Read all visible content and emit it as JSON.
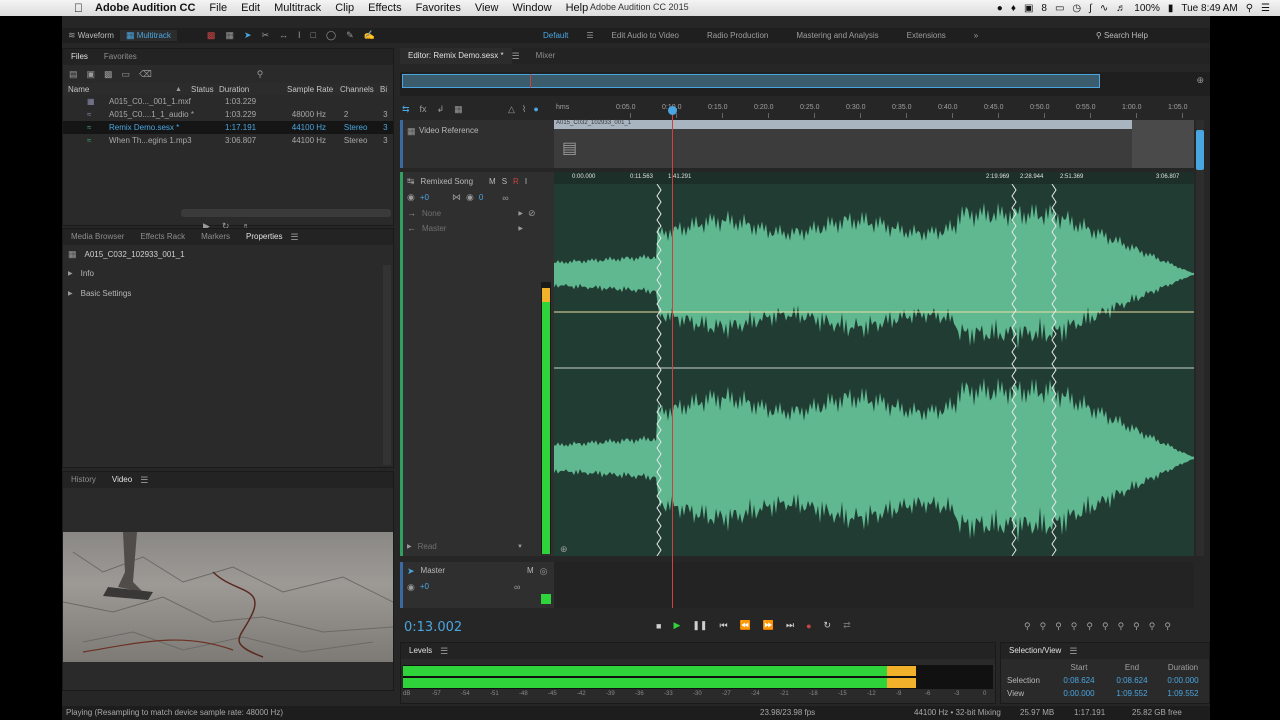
{
  "menubar": {
    "app": "Adobe Audition CC",
    "items": [
      "File",
      "Edit",
      "Multitrack",
      "Clip",
      "Effects",
      "Favorites",
      "View",
      "Window",
      "Help"
    ],
    "window_title": "Adobe Audition CC 2015",
    "tray": {
      "notifications": "8",
      "battery": "100%",
      "clock": "Tue 8:49 AM"
    }
  },
  "toolbar": {
    "waveform": "Waveform",
    "multitrack": "Multitrack",
    "workspaces": [
      "Default",
      "Edit Audio to Video",
      "Radio Production",
      "Mastering and Analysis",
      "Extensions"
    ],
    "search_help": "Search Help"
  },
  "files_panel": {
    "tabs": [
      "Files",
      "Favorites"
    ],
    "columns": [
      "Name",
      "Status",
      "Duration",
      "Sample Rate",
      "Channels",
      "Bi"
    ],
    "rows": [
      {
        "name": "A015_C0..._001_1.mxf",
        "status": "",
        "duration": "1:03.229",
        "rate": "",
        "channels": "",
        "bits": ""
      },
      {
        "name": "A015_C0....1_1_audio *",
        "status": "",
        "duration": "1:03.229",
        "rate": "48000 Hz",
        "channels": "2",
        "bits": "3"
      },
      {
        "name": "Remix Demo.sesx *",
        "status": "",
        "duration": "1:17.191",
        "rate": "44100 Hz",
        "channels": "Stereo",
        "bits": "3"
      },
      {
        "name": "When Th...egins 1.mp3",
        "status": "",
        "duration": "3:06.807",
        "rate": "44100 Hz",
        "channels": "Stereo",
        "bits": "3"
      }
    ]
  },
  "props_panel": {
    "tabs": [
      "Media Browser",
      "Effects Rack",
      "Markers",
      "Properties"
    ],
    "clip_name": "A015_C032_102933_001_1",
    "sections": [
      "Info",
      "Basic Settings"
    ]
  },
  "video_panel": {
    "tabs": [
      "History",
      "Video"
    ]
  },
  "editor": {
    "tab": "Editor: Remix Demo.sesx *",
    "mixer_tab": "Mixer",
    "ruler": [
      "hms",
      "0:05.0",
      "0:10.0",
      "0:15.0",
      "0:20.0",
      "0:25.0",
      "0:30.0",
      "0:35.0",
      "0:40.0",
      "0:45.0",
      "0:50.0",
      "0:55.0",
      "1:00.0",
      "1:05.0"
    ],
    "video_track": {
      "label": "Video Reference",
      "clip": "A015_C032_102933_001_1"
    },
    "audio_track": {
      "name": "Remixed Song",
      "m": "M",
      "s": "S",
      "r": "R",
      "i": "I",
      "vol": "+0",
      "pan": "0",
      "input": "None",
      "output": "Master",
      "mode": "Read",
      "clip_markers": [
        "0:00.000",
        "0:11.563",
        "1:41.291",
        "2:19.969",
        "2:28.944",
        "2:51.369",
        "3:06.807"
      ]
    },
    "master_track": {
      "name": "Master",
      "m": "M",
      "vol": "+0"
    },
    "timecode": "0:13.002"
  },
  "levels": {
    "title": "Levels",
    "scale": [
      "dB",
      "-57",
      "-54",
      "-51",
      "-48",
      "-45",
      "-42",
      "-39",
      "-36",
      "-33",
      "-30",
      "-27",
      "-24",
      "-21",
      "-18",
      "-15",
      "-12",
      "-9",
      "-6",
      "-3",
      "0"
    ],
    "left_level": 0.87,
    "right_level": 0.87
  },
  "selection_view": {
    "title": "Selection/View",
    "headers": [
      "Start",
      "End",
      "Duration"
    ],
    "selection": {
      "label": "Selection",
      "start": "0:08.624",
      "end": "0:08.624",
      "duration": "0:00.000"
    },
    "view": {
      "label": "View",
      "start": "0:00.000",
      "end": "1:09.552",
      "duration": "1:09.552"
    }
  },
  "statusbar": {
    "message": "Playing (Resampling to match device sample rate: 48000 Hz)",
    "fps": "23.98/23.98 fps",
    "format": "44100 Hz • 32-bit Mixing",
    "memory": "25.97 MB",
    "duration": "1:17.191",
    "free": "25.82 GB free"
  },
  "colors": {
    "accent": "#4aa6e0",
    "wave": "#5fb890",
    "wave_bg": "#203c33",
    "meter": "#2fd33a",
    "playhead": "#d04040"
  }
}
